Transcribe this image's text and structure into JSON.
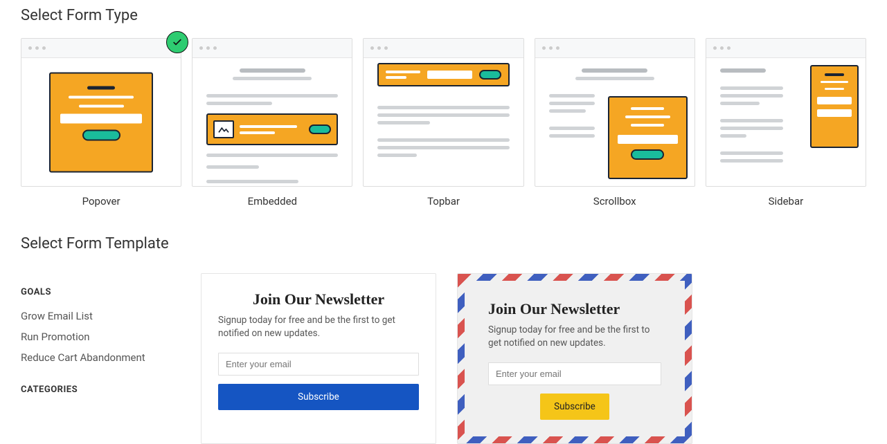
{
  "headings": {
    "select_type": "Select Form Type",
    "select_template": "Select Form Template"
  },
  "form_types": [
    {
      "id": "popover",
      "label": "Popover",
      "selected": true
    },
    {
      "id": "embedded",
      "label": "Embedded",
      "selected": false
    },
    {
      "id": "topbar",
      "label": "Topbar",
      "selected": false
    },
    {
      "id": "scrollbox",
      "label": "Scrollbox",
      "selected": false
    },
    {
      "id": "sidebar",
      "label": "Sidebar",
      "selected": false
    }
  ],
  "filters": {
    "goals_heading": "GOALS",
    "goals": [
      "Grow Email List",
      "Run Promotion",
      "Reduce Cart Abandonment"
    ],
    "categories_heading": "CATEGORIES"
  },
  "templates": {
    "plain": {
      "title": "Join Our Newsletter",
      "desc": "Signup today for free and be the first to get notified on new updates.",
      "placeholder": "Enter your email",
      "button": "Subscribe"
    },
    "airmail": {
      "title": "Join Our Newsletter",
      "desc": "Signup today for free and be the first to get notified on new updates.",
      "placeholder": "Enter your email",
      "button": "Subscribe"
    }
  }
}
